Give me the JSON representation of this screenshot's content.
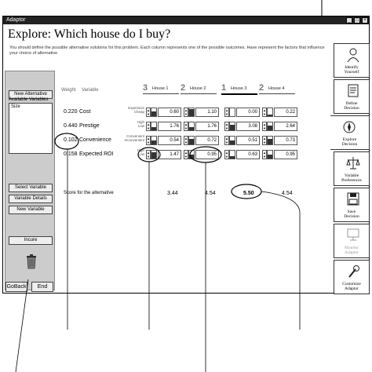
{
  "window": {
    "title": "Adaptor",
    "btn_min": "_",
    "btn_max": "□",
    "btn_close": "×"
  },
  "header": {
    "title": "Explore: Which house do I buy?",
    "intro": "You should define the possible alternative solutions for this problem. Each column represents one of the possible outcomes. Have represent the factors that influence your choice of alternative"
  },
  "left_panel": {
    "new_alternative": "New Alternative",
    "available_label": "Available Variables",
    "available_items": [
      "Size"
    ],
    "select_variable": "Select Variable",
    "variable_details": "Variable Details",
    "new_variable": "New Variable",
    "incure": "Incure",
    "trash_icon": "trash-can-icon"
  },
  "bottom": {
    "goback": "GoBack",
    "end": "End"
  },
  "table": {
    "weight_header": "Weight",
    "variable_header": "Variable",
    "alternatives": [
      {
        "rank": "3",
        "name": "House 1"
      },
      {
        "rank": "2",
        "name": "House 2"
      },
      {
        "rank": "1",
        "name": "House 3"
      },
      {
        "rank": "2",
        "name": "House 4"
      }
    ],
    "rows": [
      {
        "weight": "0.220",
        "variable": "Cost",
        "small_hi": "Expensive",
        "small_lo": "Cheap",
        "values": [
          "0.60",
          "1.10",
          "0.00",
          "0.22"
        ],
        "levels": [
          0.6,
          0.9,
          0.0,
          0.2
        ]
      },
      {
        "weight": "0.440",
        "variable": "Prestige",
        "small_hi": "High",
        "small_lo": "Low",
        "values": [
          "1.76",
          "1.76",
          "3.08",
          "2.64"
        ],
        "levels": [
          0.4,
          0.4,
          0.7,
          0.6
        ]
      },
      {
        "weight": "0.102",
        "variable": "Convenience",
        "small_hi": "Convenient",
        "small_lo": "Inconvenient",
        "values": [
          "0.54",
          "0.72",
          "0.51",
          "0.73"
        ],
        "levels": [
          0.5,
          0.7,
          0.5,
          0.7
        ]
      },
      {
        "weight": "0.158",
        "variable": "Expected ROI",
        "small_hi": "High",
        "small_lo": "Low",
        "values": [
          "1.47",
          "0.95",
          "0.63",
          "0.95"
        ],
        "levels": [
          0.8,
          0.5,
          0.3,
          0.5
        ]
      }
    ],
    "score_label": "Score for the alternative",
    "scores": [
      "3.44",
      "4.54",
      "5.50",
      "4.54"
    ]
  },
  "right_nav": [
    {
      "label": "Identify\nYourself",
      "icon": "identify-icon",
      "state": "normal"
    },
    {
      "label": "Define\nDecision",
      "icon": "define-icon",
      "state": "normal"
    },
    {
      "label": "Explore\nDecision",
      "icon": "explore-icon",
      "state": "active"
    },
    {
      "label": "Variable\nPreferences",
      "icon": "scale-icon",
      "state": "normal"
    },
    {
      "label": "Save\nDecision",
      "icon": "save-icon",
      "state": "normal"
    },
    {
      "label": "Monitor\nAdaptor",
      "icon": "monitor-icon",
      "state": "disabled"
    },
    {
      "label": "Customize\nAdaptor",
      "icon": "wrench-icon",
      "state": "normal"
    }
  ]
}
